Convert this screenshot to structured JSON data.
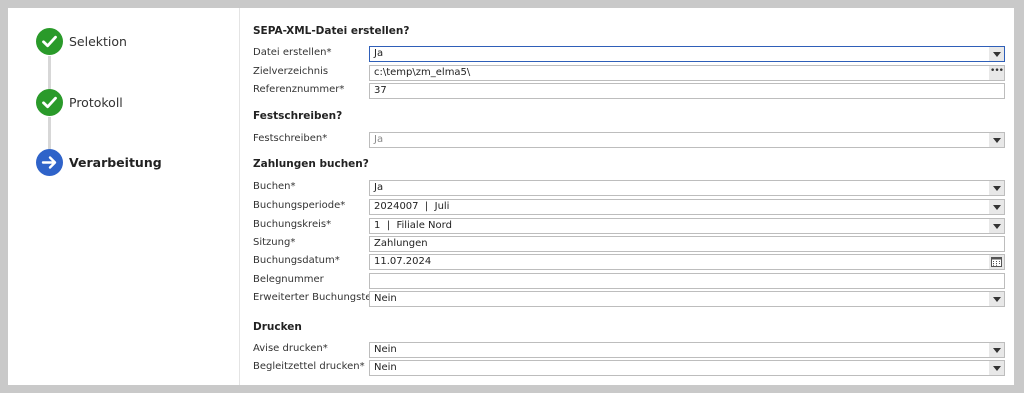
{
  "steps": [
    {
      "label": "Selektion",
      "state": "done"
    },
    {
      "label": "Protokoll",
      "state": "done"
    },
    {
      "label": "Verarbeitung",
      "state": "active"
    }
  ],
  "sections": {
    "sepa": "SEPA-XML-Datei erstellen?",
    "festschreiben": "Festschreiben?",
    "zahlungen": "Zahlungen buchen?",
    "drucken": "Drucken"
  },
  "fields": {
    "datei_erstellen": {
      "label": "Datei erstellen*",
      "value": "Ja"
    },
    "zielverzeichnis": {
      "label": "Zielverzeichnis",
      "value": "c:\\temp\\zm_elma5\\"
    },
    "referenznummer": {
      "label": "Referenznummer*",
      "value": "37"
    },
    "festschreiben": {
      "label": "Festschreiben*",
      "value": "Ja"
    },
    "buchen": {
      "label": "Buchen*",
      "value": "Ja"
    },
    "buchungsperiode": {
      "label": "Buchungsperiode*",
      "value": "2024007  |  Juli"
    },
    "buchungskreis": {
      "label": "Buchungskreis*",
      "value": "1  |  Filiale Nord"
    },
    "sitzung": {
      "label": "Sitzung*",
      "value": "Zahlungen"
    },
    "buchungsdatum": {
      "label": "Buchungsdatum*",
      "value": "11.07.2024"
    },
    "belegnummer": {
      "label": "Belegnummer",
      "value": ""
    },
    "buchungstext": {
      "label": "Erweiterter Buchungstext*",
      "value": "Nein"
    },
    "avise": {
      "label": "Avise drucken*",
      "value": "Nein"
    },
    "begleitzettel": {
      "label": "Begleitzettel drucken*",
      "value": "Nein"
    }
  },
  "icons": {
    "check": "checkmark-icon",
    "arrow": "arrow-right-icon",
    "dropdown": "chevron-down-icon",
    "browse": "ellipsis-icon",
    "calendar": "calendar-icon"
  },
  "colors": {
    "done": "#2a9a2a",
    "active": "#2f63c9",
    "focus_border": "#2f5fb8"
  }
}
